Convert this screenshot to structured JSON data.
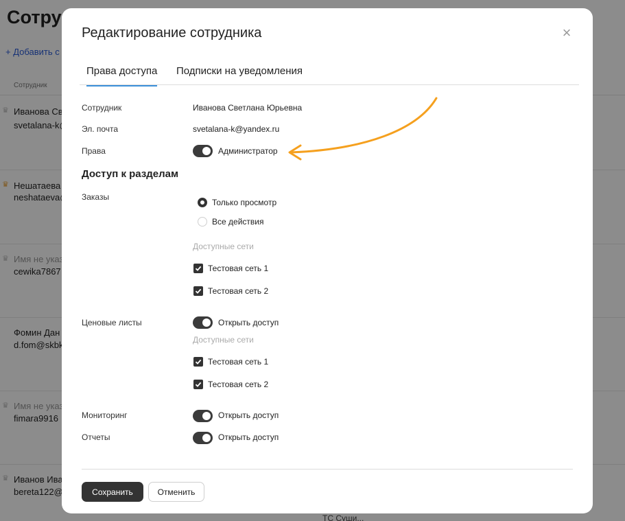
{
  "background": {
    "page_title": "Сотру",
    "add_link": "+ Добавить с",
    "column_header": "Сотрудник",
    "rows": [
      {
        "name": "Иванова Св",
        "email": "svetalana-k@",
        "muted": false,
        "crown": "grey"
      },
      {
        "name": "Нешатаева",
        "email": "neshataeva@",
        "muted": false,
        "crown": "gold"
      },
      {
        "name": "Имя не указ",
        "email": "cewika7867",
        "muted": true,
        "crown": "grey"
      },
      {
        "name": "Фомин Дан",
        "email": "d.fom@skbk",
        "muted": false,
        "crown": "none"
      },
      {
        "name": "Имя не указ",
        "email": "fimara9916",
        "muted": true,
        "crown": "grey"
      },
      {
        "name": "Иванов Ива",
        "email": "bereta122@",
        "muted": false,
        "crown": "grey"
      }
    ],
    "bottom_text": "ТС Суши..."
  },
  "modal": {
    "title": "Редактирование сотрудника",
    "close_symbol": "×",
    "tabs": [
      {
        "label": "Права доступа",
        "active": true
      },
      {
        "label": "Подписки на уведомления",
        "active": false
      }
    ],
    "employee_label": "Сотрудник",
    "employee_value": "Иванова Светлана Юрьевна",
    "email_label": "Эл. почта",
    "email_value": "svetalana-k@yandex.ru",
    "rights_label": "Права",
    "rights_toggle_label": "Администратор",
    "sections_heading": "Доступ к разделам",
    "orders": {
      "label": "Заказы",
      "options": [
        {
          "label": "Только просмотр",
          "selected": true
        },
        {
          "label": "Все действия",
          "selected": false
        }
      ],
      "networks_label": "Доступные сети",
      "networks": [
        {
          "label": "Тестовая сеть 1",
          "checked": true
        },
        {
          "label": "Тестовая сеть 2",
          "checked": true
        }
      ]
    },
    "price_lists": {
      "label": "Ценовые листы",
      "toggle_label": "Открыть доступ",
      "networks_label": "Доступные сети",
      "networks": [
        {
          "label": "Тестовая сеть 1",
          "checked": true
        },
        {
          "label": "Тестовая сеть 2",
          "checked": true
        }
      ]
    },
    "monitoring": {
      "label": "Мониторинг",
      "toggle_label": "Открыть доступ"
    },
    "reports": {
      "label": "Отчеты",
      "toggle_label": "Открыть доступ"
    },
    "save_button": "Сохранить",
    "cancel_button": "Отменить"
  },
  "colors": {
    "accent_tab": "#3a8fd9",
    "annotation_arrow": "#f5a01e",
    "toggle_on": "#3b3b3b",
    "overlay": "rgba(0,0,0,0.45)"
  }
}
